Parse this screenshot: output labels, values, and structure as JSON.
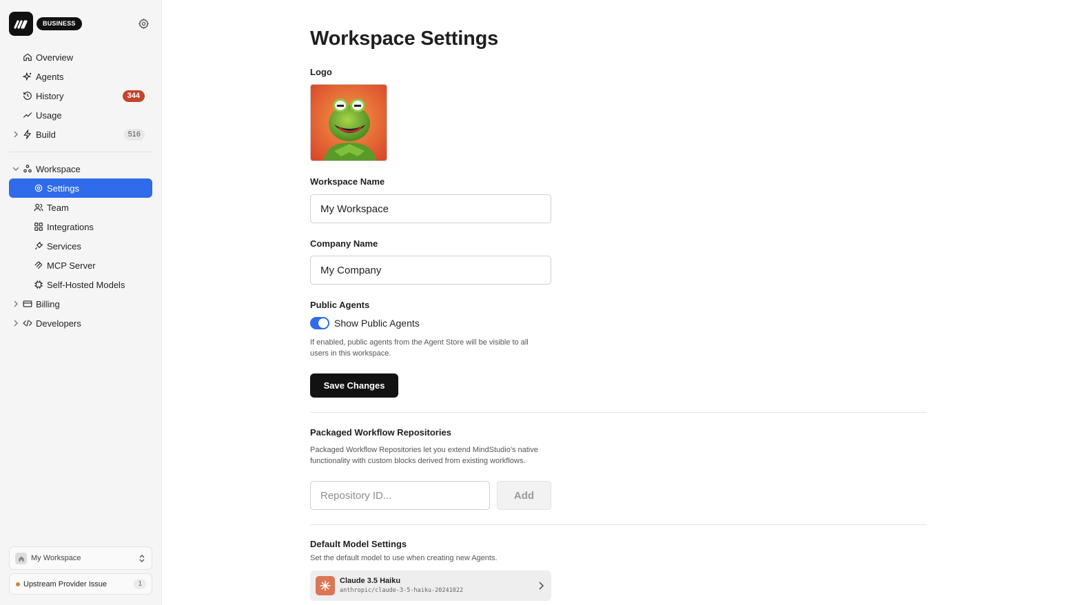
{
  "colors": {
    "accent": "#2f6bea",
    "badge_red": "#c3452e",
    "dark_button": "#121212",
    "status_dot": "#c8892e",
    "model_icon": "#d97757"
  },
  "sidebar": {
    "plan_badge": "BUSINESS",
    "items": [
      {
        "label": "Overview",
        "icon": "home-icon"
      },
      {
        "label": "Agents",
        "icon": "sparkles-icon"
      },
      {
        "label": "History",
        "icon": "history-icon",
        "badge": "344"
      },
      {
        "label": "Usage",
        "icon": "trend-icon"
      },
      {
        "label": "Build",
        "icon": "bolt-icon",
        "badge": "516",
        "collapsed": true
      },
      {
        "label": "Workspace",
        "icon": "workspace-icon",
        "expanded": true
      },
      {
        "label": "Settings",
        "icon": "gear-icon",
        "active": true
      },
      {
        "label": "Team",
        "icon": "team-icon"
      },
      {
        "label": "Integrations",
        "icon": "grid-icon"
      },
      {
        "label": "Services",
        "icon": "plug-icon"
      },
      {
        "label": "MCP Server",
        "icon": "mcp-icon"
      },
      {
        "label": "Self-Hosted Models",
        "icon": "chip-icon"
      },
      {
        "label": "Billing",
        "icon": "card-icon",
        "collapsed": true
      },
      {
        "label": "Developers",
        "icon": "code-icon",
        "collapsed": true
      }
    ],
    "workspace_switcher": "My Workspace",
    "status": {
      "label": "Upstream Provider Issue",
      "count": "1"
    }
  },
  "main": {
    "title": "Workspace Settings",
    "logo_label": "Logo",
    "workspace_name_label": "Workspace Name",
    "workspace_name_value": "My Workspace",
    "company_name_label": "Company Name",
    "company_name_value": "My Company",
    "public_agents_label": "Public Agents",
    "toggle_label": "Show Public Agents",
    "toggle_on": true,
    "toggle_help": "If enabled, public agents from the Agent Store will be visible to all users in this workspace.",
    "save_label": "Save Changes",
    "repos_title": "Packaged Workflow Repositories",
    "repos_help": "Packaged Workflow Repositories let you extend MindStudio's native functionality with custom blocks derived from existing workflows.",
    "repo_placeholder": "Repository ID...",
    "add_label": "Add",
    "model_title": "Default Model Settings",
    "model_help": "Set the default model to use when creating new Agents.",
    "model_name": "Claude 3.5 Haiku",
    "model_id": "anthropic/claude-3-5-haiku-20241022"
  }
}
